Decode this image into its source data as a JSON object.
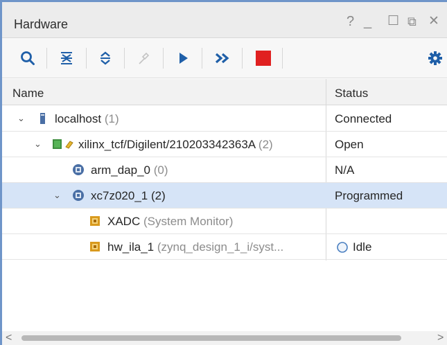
{
  "window": {
    "title": "Hardware",
    "help_glyph": "?",
    "minimize_glyph": "_",
    "maximize_glyph": "☐",
    "float_glyph": "⧉",
    "close_glyph": "✕"
  },
  "toolbar": {
    "buttons": [
      {
        "icon": "search-icon"
      },
      {
        "icon": "collapse-all-icon"
      },
      {
        "icon": "expand-all-icon"
      },
      {
        "icon": "auto-connect-icon",
        "disabled": true
      },
      {
        "icon": "run-trigger-icon"
      },
      {
        "icon": "run-trigger-immediate-icon"
      },
      {
        "icon": "stop-trigger-icon"
      },
      {
        "icon": "gear-icon"
      }
    ],
    "accent_blue": "#1f5fa8",
    "stop_red": "#e02020"
  },
  "table": {
    "columns": [
      "Name",
      "Status"
    ],
    "rows": [
      {
        "name": "localhost",
        "count": "(1)",
        "status": "Connected",
        "expander": "⌄",
        "icon": "server-icon"
      },
      {
        "name": "xilinx_tcf/Digilent/210203342363A",
        "count": "(2)",
        "status": "Open",
        "expander": "⌄",
        "icon": "jtag-cable-icon"
      },
      {
        "name": "arm_dap_0",
        "count": "(0)",
        "status": "N/A",
        "icon": "chip-icon"
      },
      {
        "name": "xc7z020_1",
        "count": "(2)",
        "status": "Programmed",
        "expander": "⌄",
        "icon": "chip-icon",
        "selected": true
      },
      {
        "name": "XADC",
        "detail": "(System Monitor)",
        "status": "",
        "icon": "debug-core-icon",
        "name_muted": true
      },
      {
        "name": "hw_ila_1",
        "detail": "(zynq_design_1_i/syst...",
        "status": "Idle",
        "icon": "debug-core-icon",
        "status_icon": "idle-circle-icon"
      }
    ]
  },
  "scrollbar": {
    "left_arrow": "<",
    "right_arrow": ">"
  }
}
